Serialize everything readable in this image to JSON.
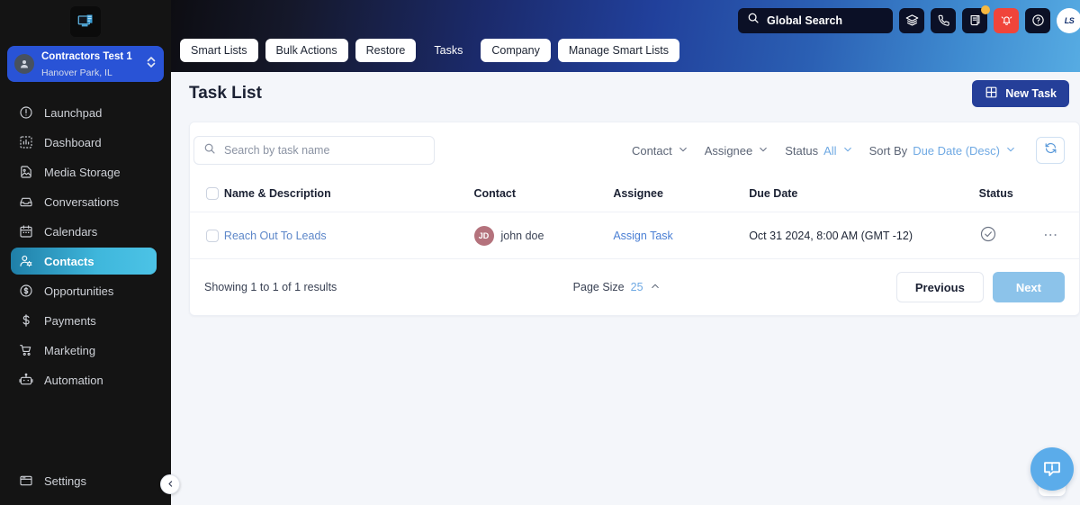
{
  "sidebar": {
    "logo_icon": "app-logo-icon",
    "account": {
      "name": "Contractors Test 1",
      "location": "Hanover Park, IL",
      "avatar_icon": "person-icon",
      "chevron_icon": "chevron-updown-icon"
    },
    "items": [
      {
        "label": "Launchpad",
        "icon": "rocket-launchpad-icon",
        "active": false
      },
      {
        "label": "Dashboard",
        "icon": "dashboard-icon",
        "active": false
      },
      {
        "label": "Media Storage",
        "icon": "image-file-icon",
        "active": false
      },
      {
        "label": "Conversations",
        "icon": "inbox-icon",
        "active": false
      },
      {
        "label": "Calendars",
        "icon": "calendar-icon",
        "active": false
      },
      {
        "label": "Contacts",
        "icon": "contacts-icon",
        "active": true
      },
      {
        "label": "Opportunities",
        "icon": "dollar-circle-icon",
        "active": false
      },
      {
        "label": "Payments",
        "icon": "dollar-sign-icon",
        "active": false
      },
      {
        "label": "Marketing",
        "icon": "shopping-cart-icon",
        "active": false
      },
      {
        "label": "Automation",
        "icon": "robot-icon",
        "active": false
      }
    ],
    "settings": {
      "label": "Settings",
      "icon": "window-settings-icon"
    },
    "collapse_icon": "chevron-left-icon",
    "active_color": "#4cc3e6"
  },
  "topbar": {
    "search": {
      "label": "Global Search",
      "icon": "search-icon"
    },
    "icons": [
      {
        "name": "layers-icon",
        "badge": false,
        "style": "dark"
      },
      {
        "name": "phone-icon",
        "badge": false,
        "style": "dark"
      },
      {
        "name": "whats-new-icon",
        "badge": true,
        "style": "dark"
      },
      {
        "name": "bell-icon",
        "badge": false,
        "style": "alert"
      },
      {
        "name": "help-circle-icon",
        "badge": false,
        "style": "dark"
      }
    ],
    "user_avatar_text": "LS",
    "alert_color": "#f0453a",
    "badge_color": "#f5b841"
  },
  "tabs": [
    {
      "label": "Smart Lists",
      "active": false
    },
    {
      "label": "Bulk Actions",
      "active": false
    },
    {
      "label": "Restore",
      "active": false
    },
    {
      "label": "Tasks",
      "active": true
    },
    {
      "label": "Company",
      "active": false
    },
    {
      "label": "Manage Smart Lists",
      "active": false
    }
  ],
  "page": {
    "title": "Task List",
    "new_task_label": "New Task",
    "new_task_icon": "grid-plus-icon",
    "new_task_color": "#253f99"
  },
  "filters": {
    "search_placeholder": "Search by task name",
    "search_value": "",
    "search_icon": "search-icon",
    "contact": {
      "label": "Contact",
      "value": "",
      "icon": "chevron-down-icon"
    },
    "assignee": {
      "label": "Assignee",
      "value": "",
      "icon": "chevron-down-icon"
    },
    "status": {
      "label": "Status",
      "value": "All",
      "icon": "chevron-down-icon"
    },
    "sort_by": {
      "label": "Sort By",
      "value": "Due Date (Desc)",
      "icon": "chevron-down-icon"
    },
    "refresh_icon": "refresh-icon"
  },
  "table": {
    "columns": [
      "Name & Description",
      "Contact",
      "Assignee",
      "Due Date",
      "Status"
    ],
    "select_all_checked": false,
    "rows": [
      {
        "checked": false,
        "name": "Reach Out To Leads",
        "contact_initials": "JD",
        "contact_name": "john doe",
        "contact_avatar_color": "#b4727c",
        "assignee": "Assign Task",
        "due_date": "Oct 31 2024, 8:00 AM (GMT -12)",
        "status_icon": "check-circle-icon",
        "more_icon": "ellipsis-icon"
      }
    ]
  },
  "footer": {
    "showing": "Showing 1 to 1 of 1 results",
    "page_size_label": "Page Size",
    "page_size_value": "25",
    "page_size_icon": "chevron-up-icon",
    "previous_label": "Previous",
    "next_label": "Next",
    "next_color": "#8cc3ea"
  },
  "chat_widget": {
    "icon": "chat-info-icon",
    "color": "#5bacea"
  }
}
